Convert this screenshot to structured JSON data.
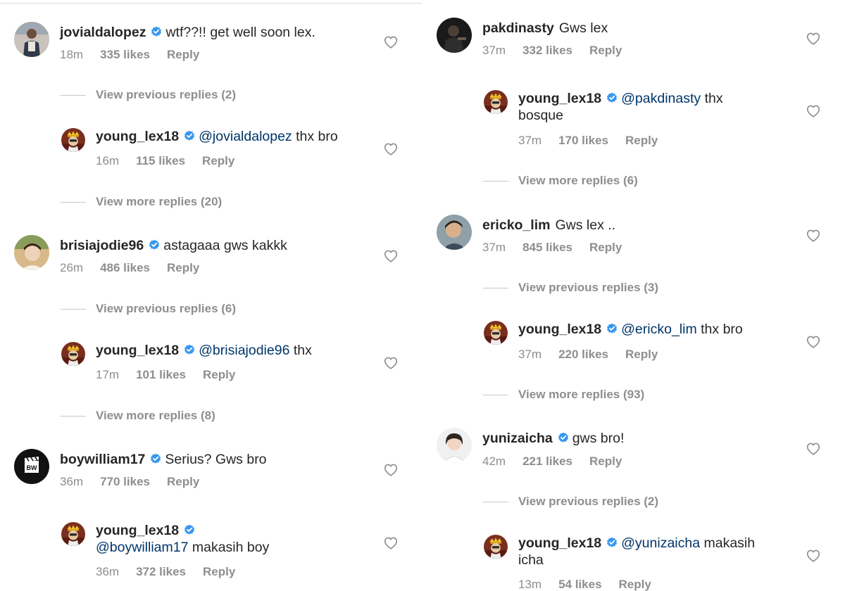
{
  "colors": {
    "text": "#262626",
    "muted": "#8e8e8e",
    "mention": "#003569",
    "verified": "#3897f0"
  },
  "left_column": {
    "c1": {
      "username": "jovialdalopez",
      "verified": true,
      "text": "wtf??!! get well soon lex.",
      "time": "18m",
      "likes": "335 likes",
      "reply": "Reply",
      "avatar_icon": "user-avatar-icon",
      "like_icon": "heart-icon"
    },
    "c1_prev": "View previous replies (2)",
    "r1": {
      "username": "young_lex18",
      "verified": true,
      "mention": "@jovialdalopez",
      "text": " thx bro",
      "time": "16m",
      "likes": "115 likes",
      "reply": "Reply"
    },
    "r1_more": "View more replies (20)",
    "c2": {
      "username": "brisiajodie96",
      "verified": true,
      "text": "astagaaa gws kakkk",
      "time": "26m",
      "likes": "486 likes",
      "reply": "Reply"
    },
    "c2_prev": "View previous replies (6)",
    "r2": {
      "username": "young_lex18",
      "verified": true,
      "mention": "@brisiajodie96",
      "text": " thx",
      "time": "17m",
      "likes": "101 likes",
      "reply": "Reply"
    },
    "r2_more": "View more replies (8)",
    "c3": {
      "username": "boywilliam17",
      "verified": true,
      "text": "Serius? Gws bro",
      "time": "36m",
      "likes": "770 likes",
      "reply": "Reply"
    },
    "r3": {
      "username": "young_lex18",
      "verified": true,
      "mention": "@boywilliam17",
      "text": " makasih boy",
      "time": "36m",
      "likes": "372 likes",
      "reply": "Reply"
    }
  },
  "right_column": {
    "c4": {
      "username": "pakdinasty",
      "verified": false,
      "text": "Gws lex",
      "time": "37m",
      "likes": "332 likes",
      "reply": "Reply"
    },
    "r4": {
      "username": "young_lex18",
      "verified": true,
      "mention": "@pakdinasty",
      "text": " thx bosque",
      "time": "37m",
      "likes": "170 likes",
      "reply": "Reply"
    },
    "r4_more": "View more replies (6)",
    "c5": {
      "username": "ericko_lim",
      "verified": false,
      "text": "Gws lex ..",
      "time": "37m",
      "likes": "845 likes",
      "reply": "Reply"
    },
    "c5_prev": "View previous replies (3)",
    "r5": {
      "username": "young_lex18",
      "verified": true,
      "mention": "@ericko_lim",
      "text": " thx bro",
      "time": "37m",
      "likes": "220 likes",
      "reply": "Reply"
    },
    "r5_more": "View more replies (93)",
    "c6": {
      "username": "yunizaicha",
      "verified": true,
      "text": "gws bro!",
      "time": "42m",
      "likes": "221 likes",
      "reply": "Reply"
    },
    "c6_prev": "View previous replies (2)",
    "r6": {
      "username": "young_lex18",
      "verified": true,
      "mention": "@yunizaicha",
      "text": " makasih icha",
      "time": "13m",
      "likes": "54 likes",
      "reply": "Reply"
    }
  }
}
